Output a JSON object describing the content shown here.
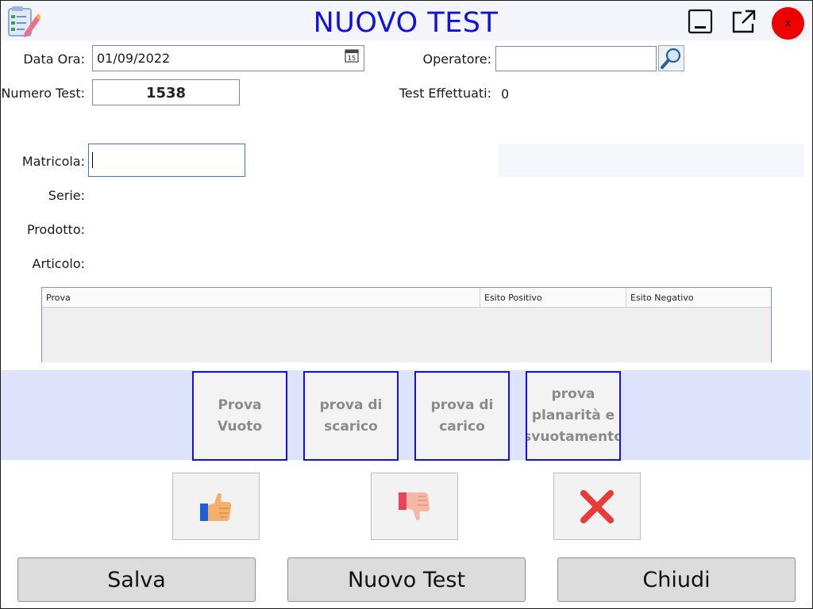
{
  "window": {
    "title": "NUOVO TEST",
    "icons": [
      "checklist-edit-icon",
      "minimize-icon",
      "external-open-icon"
    ],
    "close_label": "x"
  },
  "form": {
    "data_ora_label": "Data Ora:",
    "data_ora_value": "01/09/2022",
    "calendar_day": "15",
    "operatore_label": "Operatore:",
    "operatore_value": "",
    "numero_test_label": "Numero Test:",
    "numero_test_value": "1538",
    "test_effettuati_label": "Test Effettuati:",
    "test_effettuati_value": "0",
    "matricola_label": "Matricola:",
    "serie_label": "Serie:",
    "prodotto_label": "Prodotto:",
    "articolo_label": "Articolo:"
  },
  "grid": {
    "columns": [
      "Prova",
      "Esito Positivo",
      "Esito Negativo"
    ],
    "rows": []
  },
  "prove": [
    {
      "label": "Prova Vuoto"
    },
    {
      "label": "prova di scarico"
    },
    {
      "label": "prova di carico"
    },
    {
      "label": "prova planarità e svuotamento"
    }
  ],
  "actions": {
    "positive_icon": "thumbs-up-icon",
    "negative_icon": "thumbs-down-icon",
    "cancel_icon": "red-x-icon"
  },
  "buttons": {
    "salva": "Salva",
    "nuovo_test": "Nuovo Test",
    "chiudi": "Chiudi"
  },
  "colors": {
    "title": "#1010e0",
    "accent_border": "#1212d8",
    "band": "#dde3fb",
    "close": "#ee0000"
  }
}
